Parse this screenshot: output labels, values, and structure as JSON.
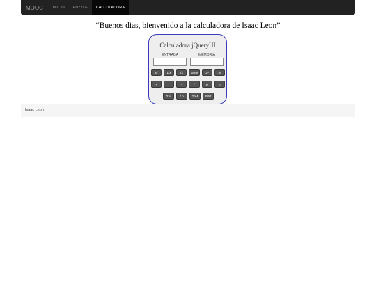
{
  "navbar": {
    "brand": "MOOC",
    "links": [
      {
        "label": "INICIO",
        "active": false
      },
      {
        "label": "PUZZLE",
        "active": false
      },
      {
        "label": "CALCULADORA",
        "active": true
      }
    ]
  },
  "welcome": "“Buenos dias, bienvenido a la calculadora de Isaac Leon”",
  "calculator": {
    "title": "Calculadora jQueryUI",
    "entrada_label": "ENTRADA",
    "memoria_label": "MEMORIA",
    "entrada_value": "",
    "memoria_value": "",
    "row1": [
      "x²",
      "1/x",
      "√x",
      "parte",
      "2ⁿ",
      "n!"
    ],
    "row2": [
      "+",
      "-",
      "*",
      "/",
      "xʸ",
      "="
    ],
    "row3": [
      "Σ x",
      "* n",
      "ToM",
      "FrM"
    ]
  },
  "footer": "Isaac Leon"
}
